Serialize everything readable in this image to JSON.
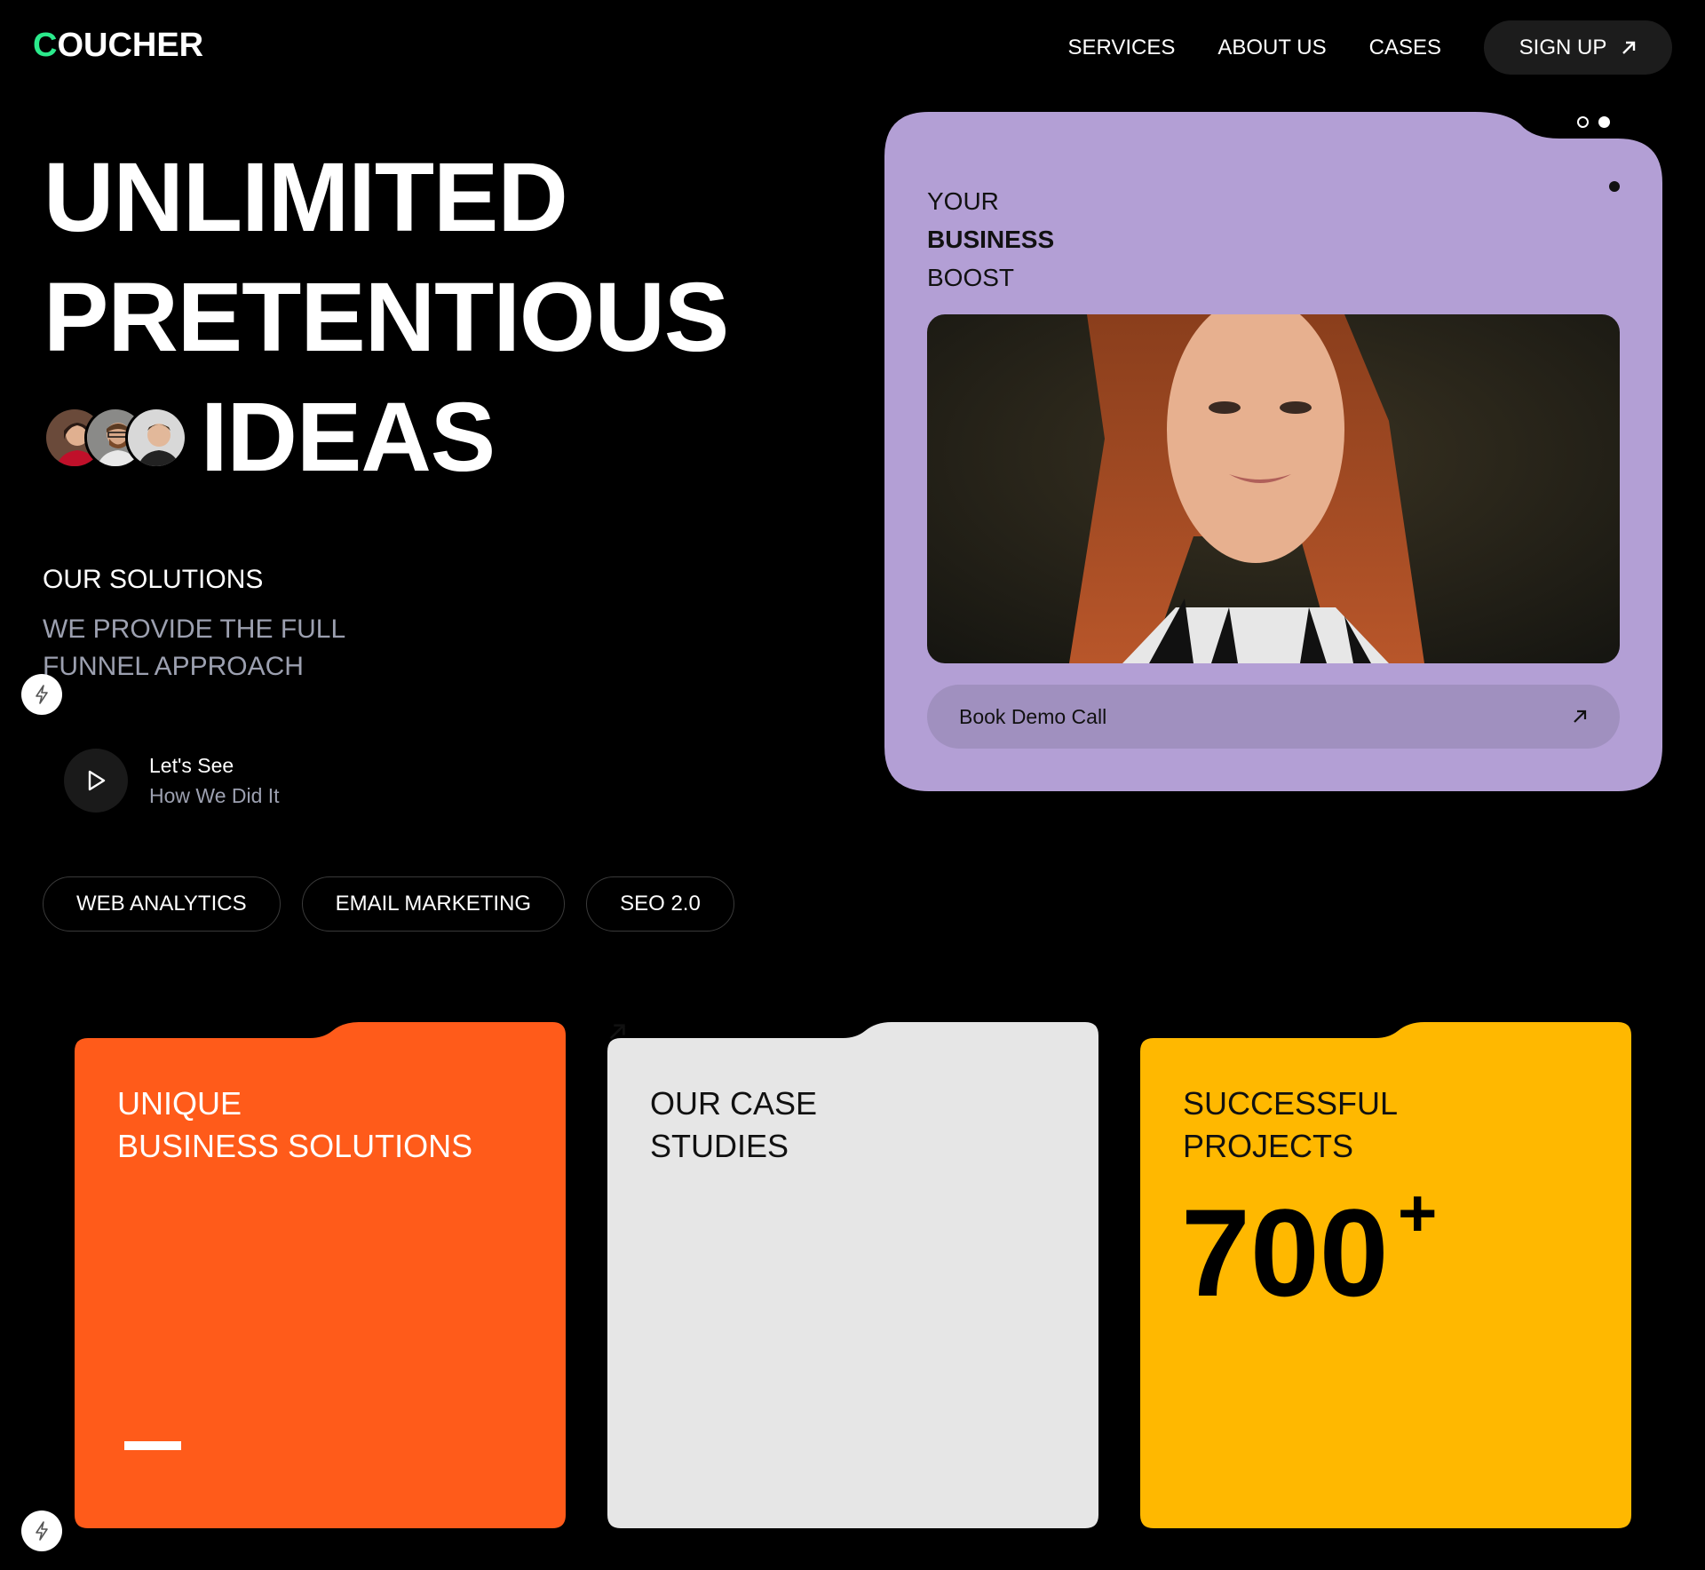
{
  "header": {
    "logo_first": "C",
    "logo_rest": "OUCHER",
    "nav": [
      "SERVICES",
      "ABOUT US",
      "CASES"
    ],
    "signup": "SIGN UP",
    "accent": "#2bea8c"
  },
  "hero": {
    "line1": "UNLIMITED",
    "line2": "PRETENTIOUS",
    "line3": "IDEAS"
  },
  "solutions": {
    "title": "OUR SOLUTIONS",
    "subtitle": "WE PROVIDE THE FULL FUNNEL APPROACH"
  },
  "video": {
    "line1": "Let's See",
    "line2": "How We Did It"
  },
  "tags": [
    "WEB ANALYTICS",
    "EMAIL MARKETING",
    "SEO 2.0"
  ],
  "promo_card": {
    "line1": "YOUR",
    "line2": "BUSINESS",
    "line3": "BOOST",
    "button": "Book Demo Call",
    "color": "#b39fd5"
  },
  "cards": [
    {
      "line1": "UNIQUE",
      "line2": "BUSINESS SOLUTIONS",
      "color": "#ff5b1a"
    },
    {
      "line1": "OUR CASE",
      "line2": "STUDIES",
      "color": "#e6e6e6"
    },
    {
      "line1": "SUCCESSFUL",
      "line2": "PROJECTS",
      "number": "700",
      "suffix": "+",
      "color": "#ffb800"
    }
  ]
}
